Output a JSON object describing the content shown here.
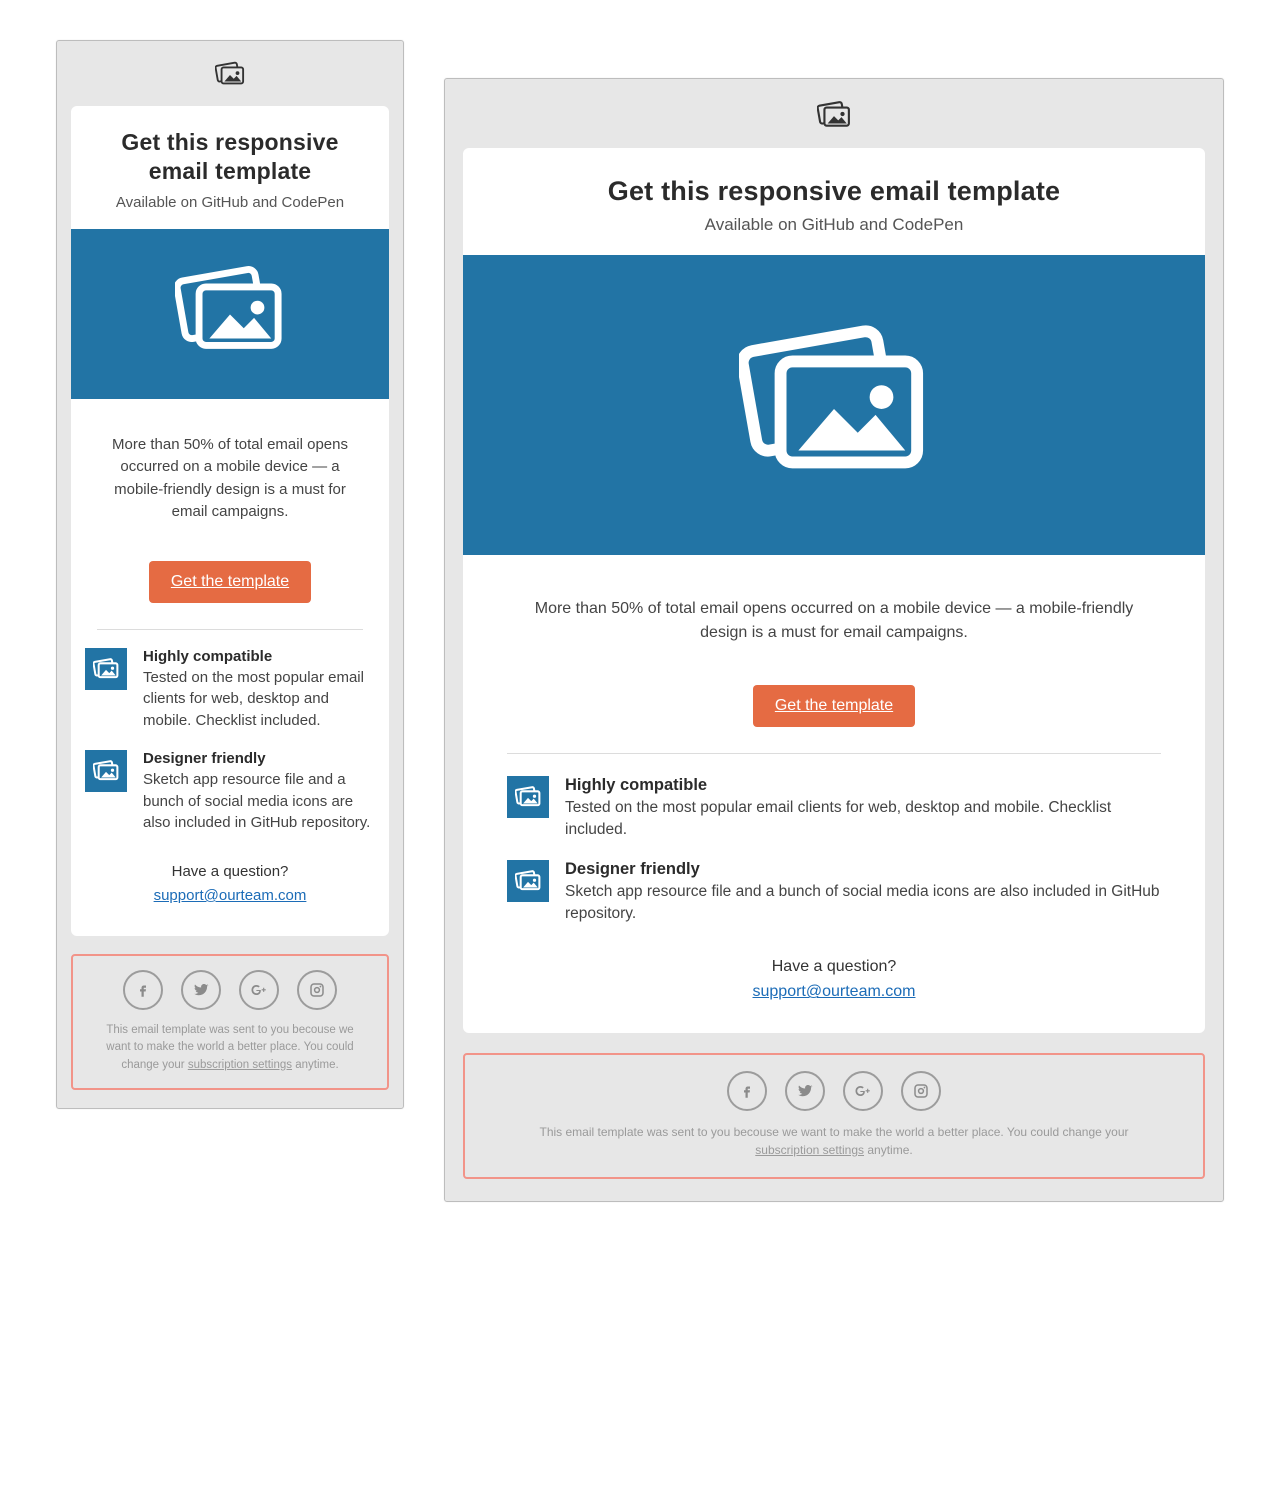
{
  "colors": {
    "accent": "#2274a5",
    "cta": "#e56b43",
    "link": "#1c6cb7",
    "highlight_border": "#f29489"
  },
  "header": {
    "title": "Get this responsive email template",
    "subtitle": "Available on GitHub and CodePen"
  },
  "hero": {
    "icon": "photo-stack-icon"
  },
  "lead": "More than 50% of total email opens occurred on a mobile device — a mobile-friendly design is a must for email campaigns.",
  "cta_label": "Get the template",
  "features": [
    {
      "icon": "photo-stack-icon",
      "title": "Highly compatible",
      "body": "Tested on the most popular email clients for web, desktop and mobile. Checklist included."
    },
    {
      "icon": "photo-stack-icon",
      "title": "Designer friendly",
      "body": "Sketch app resource file and a bunch of social media icons are also included in GitHub repository."
    }
  ],
  "support": {
    "question": "Have a question?",
    "email": "support@ourteam.com"
  },
  "footer": {
    "socials": [
      "facebook",
      "twitter",
      "google-plus",
      "instagram"
    ],
    "disclaimer_pre": "This email template was sent to you becouse we want to make the world a better place. You could change your ",
    "disclaimer_link": "subscription settings",
    "disclaimer_post": " anytime."
  }
}
